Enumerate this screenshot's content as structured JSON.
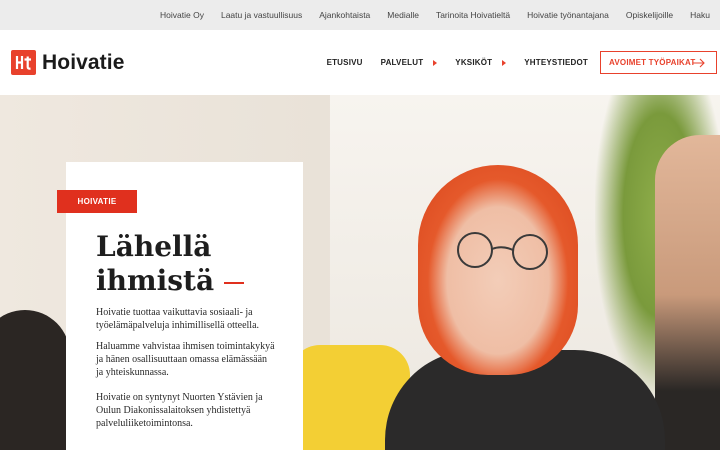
{
  "topbar": {
    "links": [
      "Hoivatie Oy",
      "Laatu ja vastuullisuus",
      "Ajankohtaista",
      "Medialle",
      "Tarinoita Hoivatieltä",
      "Hoivatie työnantajana",
      "Opiskelijoille",
      "Haku"
    ]
  },
  "header": {
    "logo_text": "Hoivatie",
    "nav": [
      {
        "label": "ETUSIVU",
        "has_submenu": false
      },
      {
        "label": "PALVELUT",
        "has_submenu": true
      },
      {
        "label": "YKSIKÖT",
        "has_submenu": true
      },
      {
        "label": "YHTEYSTIEDOT",
        "has_submenu": false
      }
    ],
    "cta_label": "AVOIMET TYÖPAIKAT"
  },
  "hero": {
    "tag": "HOIVATIE",
    "headline_line1": "Lähellä",
    "headline_line2": "ihmistä",
    "paragraphs": [
      "Hoivatie tuottaa vaikuttavia sosiaali- ja työelämäpalveluja inhimillisellä otteella.",
      "Haluamme vahvistaa ihmisen toimintakykyä ja hänen osallisuuttaan omassa elämässään ja yhteiskunnassa.",
      "Hoivatie on syntynyt Nuorten Ystävien ja Oulun Diakonissalaitoksen yhdistettyä palveluliiketoimintonsa."
    ]
  },
  "colors": {
    "brand_red": "#e8412c",
    "tag_red": "#e0301e",
    "topbar_bg": "#ececec"
  }
}
